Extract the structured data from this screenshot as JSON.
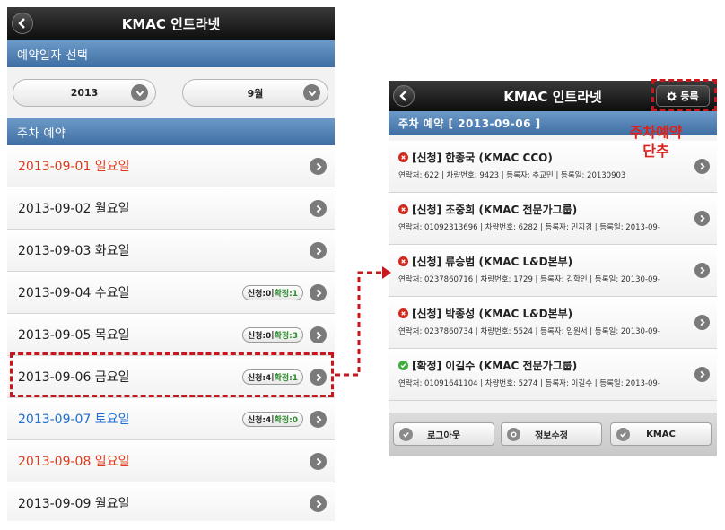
{
  "left": {
    "header": {
      "title": "KMAC 인트라넷"
    },
    "date_select": {
      "section_title": "예약일자 선택",
      "year": "2013",
      "month": "9월"
    },
    "parking": {
      "section_title": "주차 예약",
      "days": [
        {
          "label": "2013-09-01 일요일",
          "color": "#e03a1c",
          "badge": null
        },
        {
          "label": "2013-09-02 월요일",
          "color": "#222222",
          "badge": null
        },
        {
          "label": "2013-09-03 화요일",
          "color": "#222222",
          "badge": null
        },
        {
          "label": "2013-09-04 수요일",
          "color": "#222222",
          "badge": {
            "apply": "신청:0",
            "confirm": "확정:1"
          }
        },
        {
          "label": "2013-09-05 목요일",
          "color": "#222222",
          "badge": {
            "apply": "신청:0",
            "confirm": "확정:3"
          }
        },
        {
          "label": "2013-09-06 금요일",
          "color": "#222222",
          "badge": {
            "apply": "신청:4",
            "confirm": "확정:1"
          }
        },
        {
          "label": "2013-09-07 토요일",
          "color": "#1e6fcf",
          "badge": {
            "apply": "신청:4",
            "confirm": "확정:0"
          }
        },
        {
          "label": "2013-09-08 일요일",
          "color": "#e03a1c",
          "badge": null
        },
        {
          "label": "2013-09-09 월요일",
          "color": "#222222",
          "badge": null
        }
      ]
    }
  },
  "right": {
    "header": {
      "title": "KMAC 인트라넷",
      "register_label": "등록"
    },
    "section_title": "주차 예약 [ 2013-09-06 ]",
    "reservations": [
      {
        "status": "rejected",
        "title": "[신청] 한종국 (KMAC CCO)",
        "detail": "연락처: 622 | 차량번호: 9423 | 등록자: 추교민 | 등록일: 20130903"
      },
      {
        "status": "rejected",
        "title": "[신청] 조중희 (KMAC 전문가그룹)",
        "detail": "연락처: 01092313696 | 차량번호: 6282 | 등록자: 민지경 | 등록일: 2013-09-"
      },
      {
        "status": "rejected",
        "title": "[신청] 류승범 (KMAC L&D본부)",
        "detail": "연락처: 0237860716 | 차량번호: 1729 | 등록자: 김학인 | 등록일: 20130-09-"
      },
      {
        "status": "rejected",
        "title": "[신청] 박종성 (KMAC L&D본부)",
        "detail": "연락처: 0237860734 | 차량번호: 5524 | 등록자: 임원서 | 등록일: 20130-09-"
      },
      {
        "status": "confirmed",
        "title": "[확정] 이길수 (KMAC 전문가그룹)",
        "detail": "연락처: 01091641104 | 차량번호: 5274 | 등록자: 이길수 | 등록일: 2013-09-"
      }
    ],
    "footer": {
      "logout": "로그아웃",
      "edit_info": "정보수정",
      "kmac": "KMAC"
    }
  },
  "annotation": {
    "line1": "주차예약",
    "line2": "단추",
    "color": "#e0201b"
  }
}
